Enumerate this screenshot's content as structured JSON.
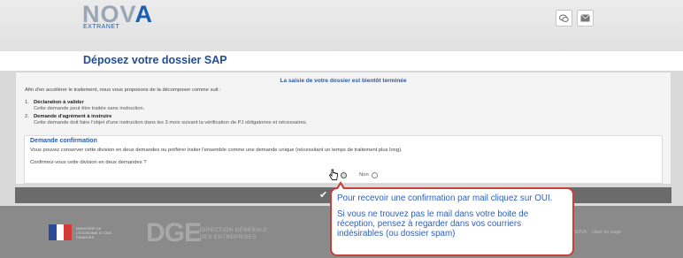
{
  "header": {
    "logo_main": "NOV",
    "logo_accent": "A",
    "logo_sub": "EXTRANET",
    "icons": [
      "chat-icon",
      "mail-icon"
    ]
  },
  "page": {
    "title": "Déposez votre dossier SAP"
  },
  "content": {
    "heading": "La saisie de votre dossier est bientôt terminée",
    "intro": "Afin d'en accélérer le traitement, nous vous proposons de la décomposer comme suit :",
    "steps": [
      {
        "num": "1.",
        "title": "Déclaration à valider",
        "desc": "Cette demande peut être traitée sans instruction."
      },
      {
        "num": "2.",
        "title": "Demande d'agrément à instruire",
        "desc": "Cette demande doit faire l'objet d'une instruction dans les 3 mois suivant la vérification de PJ obligatoires et nécessaires."
      }
    ]
  },
  "confirm": {
    "title": "Demande confirmation",
    "text": "Vous pouvez conserver cette division en deux demandes ou préférer traiter l'ensemble comme une demande unique (nécessitant un temps de traitement plus long).",
    "question": "Confirmez-vous cette division en deux demandes ?",
    "yes_label": "Oui",
    "no_label": "Non",
    "selected": "Oui"
  },
  "footer": {
    "ministry": "MINISTÈRE DE L'ÉCONOMIE ET DES FINANCES",
    "dge_logo": "DGE",
    "dge_line1": "DIRECTION GÉNÉRALE",
    "dge_line2": "DES ENTREPRISES",
    "links": [
      "NOVA",
      "Haut de page"
    ]
  },
  "callout": {
    "line1": "Pour recevoir une confirmation par mail cliquez sur OUI.",
    "line2": "Si vous ne trouvez pas le mail dans votre boite de réception, pensez à regarder dans vos courriers indésirables (ou dossier spam)"
  },
  "colors": {
    "accent": "#1f4e96",
    "callout_border": "#c8403a",
    "callout_text": "#2c5fbf",
    "footer_bg": "#8a8a8a"
  }
}
